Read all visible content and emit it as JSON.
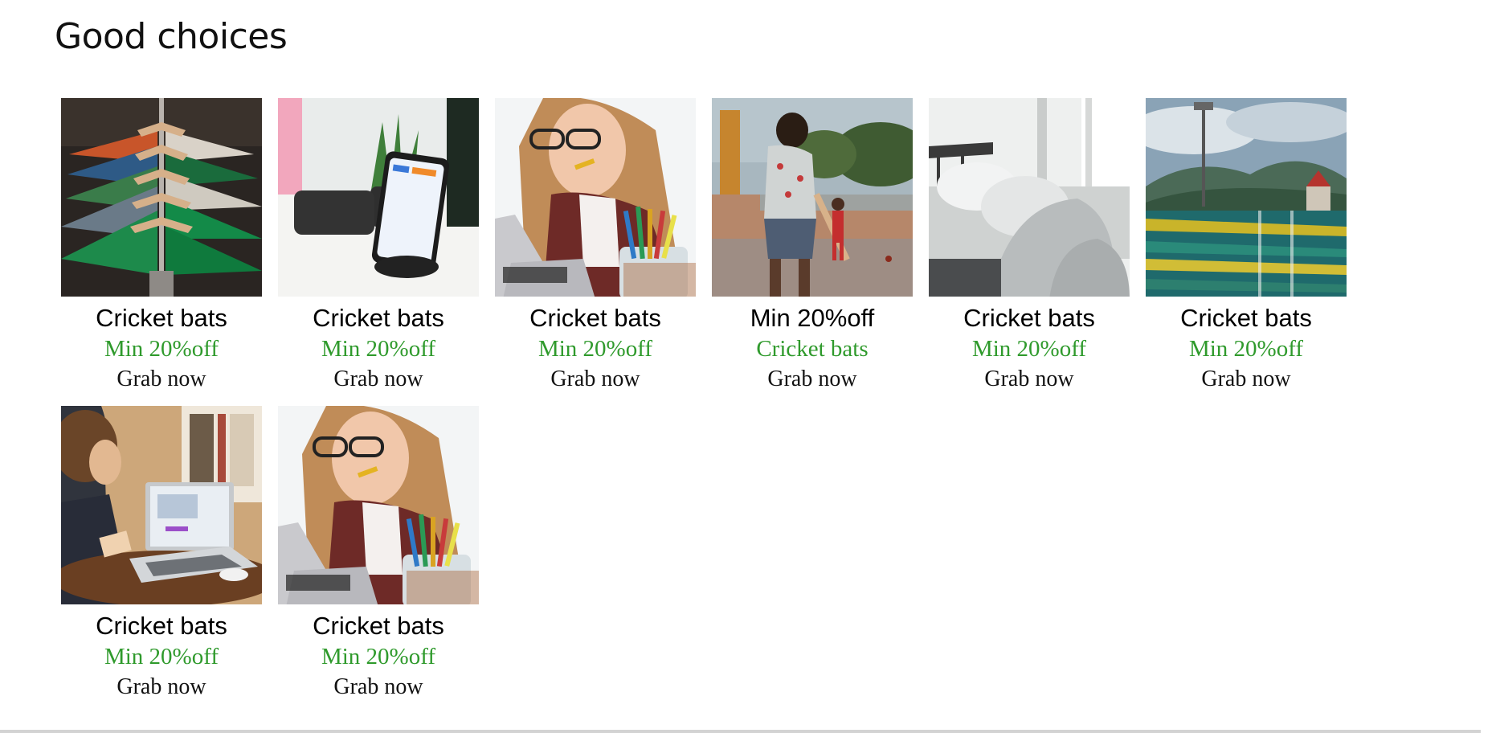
{
  "section": {
    "title": "Good choices"
  },
  "cards": [
    {
      "title": "Cricket bats",
      "subtitle": "Min 20%off",
      "cta": "Grab now",
      "image": "clothes-rack-photo"
    },
    {
      "title": "Cricket bats",
      "subtitle": "Min 20%off",
      "cta": "Grab now",
      "image": "phone-charger-desk-photo"
    },
    {
      "title": "Cricket bats",
      "subtitle": "Min 20%off",
      "cta": "Grab now",
      "image": "woman-laptop-pencils-photo"
    },
    {
      "title": "Min 20%off",
      "subtitle": "Cricket bats",
      "cta": "Grab now",
      "image": "boy-playing-cricket-photo"
    },
    {
      "title": "Cricket bats",
      "subtitle": "Min 20%off",
      "cta": "Grab now",
      "image": "bedroom-pillows-photo"
    },
    {
      "title": "Cricket bats",
      "subtitle": "Min 20%off",
      "cta": "Grab now",
      "image": "cricket-stadium-photo"
    },
    {
      "title": "Cricket bats",
      "subtitle": "Min 20%off",
      "cta": "Grab now",
      "image": "person-laptop-desk-photo"
    },
    {
      "title": "Cricket bats",
      "subtitle": "Min 20%off",
      "cta": "Grab now",
      "image": "woman-laptop-pencils-photo"
    }
  ],
  "colors": {
    "subtitle": "#2f9a2c",
    "title": "#000000"
  }
}
